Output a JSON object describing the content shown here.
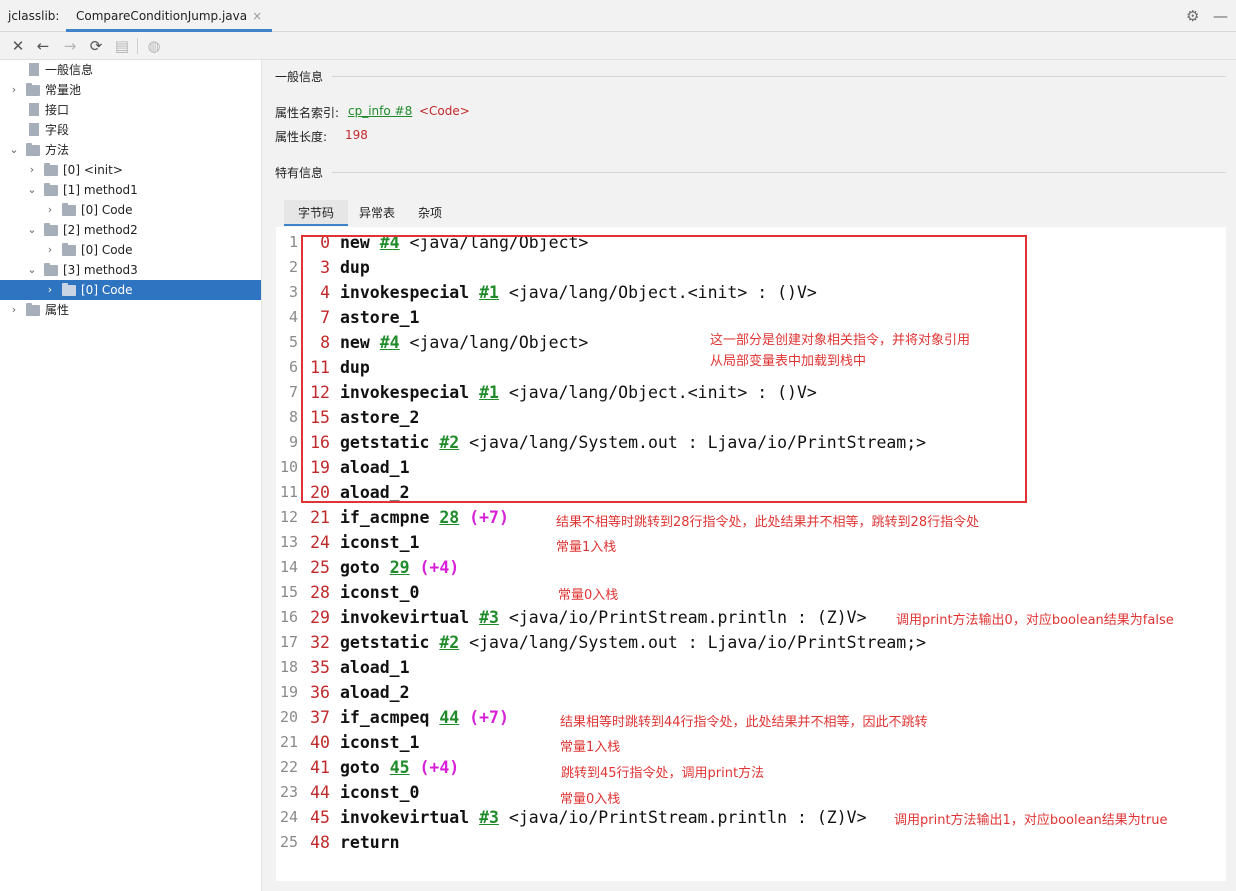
{
  "app": {
    "name": "jclasslib:",
    "file_tab": "CompareConditionJump.java",
    "tab_close": "×",
    "settings_icon": "gear-icon",
    "minimize_icon": "minus-icon"
  },
  "toolbar": {
    "close": "✕",
    "back": "←",
    "forward": "→",
    "refresh": "⟳",
    "save": "▤",
    "web": "◍"
  },
  "tree": {
    "items": [
      {
        "label": "一般信息",
        "level": 0,
        "type": "page",
        "chevron": ""
      },
      {
        "label": "常量池",
        "level": 0,
        "type": "folder",
        "chevron": "›"
      },
      {
        "label": "接口",
        "level": 0,
        "type": "page",
        "chevron": ""
      },
      {
        "label": "字段",
        "level": 0,
        "type": "page",
        "chevron": ""
      },
      {
        "label": "方法",
        "level": 0,
        "type": "folder",
        "chevron": "⌄"
      },
      {
        "label": "[0] <init>",
        "level": 1,
        "type": "folder",
        "chevron": "›"
      },
      {
        "label": "[1] method1",
        "level": 1,
        "type": "folder",
        "chevron": "⌄"
      },
      {
        "label": "[0] Code",
        "level": 2,
        "type": "folder",
        "chevron": "›"
      },
      {
        "label": "[2] method2",
        "level": 1,
        "type": "folder",
        "chevron": "⌄"
      },
      {
        "label": "[0] Code",
        "level": 2,
        "type": "folder",
        "chevron": "›"
      },
      {
        "label": "[3] method3",
        "level": 1,
        "type": "folder",
        "chevron": "⌄"
      },
      {
        "label": "[0] Code",
        "level": 2,
        "type": "folder",
        "chevron": "›",
        "selected": true
      },
      {
        "label": "属性",
        "level": 0,
        "type": "folder",
        "chevron": "›"
      }
    ]
  },
  "general": {
    "title": "一般信息",
    "name_index_label": "属性名索引:",
    "name_index_link": "cp_info #8",
    "name_index_value": "<Code>",
    "length_label": "属性长度:",
    "length_value": "198"
  },
  "specific": {
    "title": "特有信息",
    "tabs": [
      "字节码",
      "异常表",
      "杂项"
    ]
  },
  "code_lines": [
    {
      "ln": "1",
      "off": "0",
      "instr": "new",
      "ref": "#4",
      "rest": " <java/lang/Object>",
      "jump": ""
    },
    {
      "ln": "2",
      "off": "3",
      "instr": "dup",
      "ref": "",
      "rest": "",
      "jump": ""
    },
    {
      "ln": "3",
      "off": "4",
      "instr": "invokespecial",
      "ref": "#1",
      "rest": " <java/lang/Object.<init> : ()V>",
      "jump": ""
    },
    {
      "ln": "4",
      "off": "7",
      "instr": "astore_1",
      "ref": "",
      "rest": "",
      "jump": ""
    },
    {
      "ln": "5",
      "off": "8",
      "instr": "new",
      "ref": "#4",
      "rest": " <java/lang/Object>",
      "jump": ""
    },
    {
      "ln": "6",
      "off": "11",
      "instr": "dup",
      "ref": "",
      "rest": "",
      "jump": ""
    },
    {
      "ln": "7",
      "off": "12",
      "instr": "invokespecial",
      "ref": "#1",
      "rest": " <java/lang/Object.<init> : ()V>",
      "jump": ""
    },
    {
      "ln": "8",
      "off": "15",
      "instr": "astore_2",
      "ref": "",
      "rest": "",
      "jump": ""
    },
    {
      "ln": "9",
      "off": "16",
      "instr": "getstatic",
      "ref": "#2",
      "rest": " <java/lang/System.out : Ljava/io/PrintStream;>",
      "jump": ""
    },
    {
      "ln": "10",
      "off": "19",
      "instr": "aload_1",
      "ref": "",
      "rest": "",
      "jump": ""
    },
    {
      "ln": "11",
      "off": "20",
      "instr": "aload_2",
      "ref": "",
      "rest": "",
      "jump": ""
    },
    {
      "ln": "12",
      "off": "21",
      "instr": "if_acmpne",
      "ref": "28",
      "rest": " ",
      "jump": "(+7)"
    },
    {
      "ln": "13",
      "off": "24",
      "instr": "iconst_1",
      "ref": "",
      "rest": "",
      "jump": ""
    },
    {
      "ln": "14",
      "off": "25",
      "instr": "goto",
      "ref": "29",
      "rest": " ",
      "jump": "(+4)"
    },
    {
      "ln": "15",
      "off": "28",
      "instr": "iconst_0",
      "ref": "",
      "rest": "",
      "jump": ""
    },
    {
      "ln": "16",
      "off": "29",
      "instr": "invokevirtual",
      "ref": "#3",
      "rest": " <java/io/PrintStream.println : (Z)V>",
      "jump": ""
    },
    {
      "ln": "17",
      "off": "32",
      "instr": "getstatic",
      "ref": "#2",
      "rest": " <java/lang/System.out : Ljava/io/PrintStream;>",
      "jump": ""
    },
    {
      "ln": "18",
      "off": "35",
      "instr": "aload_1",
      "ref": "",
      "rest": "",
      "jump": ""
    },
    {
      "ln": "19",
      "off": "36",
      "instr": "aload_2",
      "ref": "",
      "rest": "",
      "jump": ""
    },
    {
      "ln": "20",
      "off": "37",
      "instr": "if_acmpeq",
      "ref": "44",
      "rest": " ",
      "jump": "(+7)"
    },
    {
      "ln": "21",
      "off": "40",
      "instr": "iconst_1",
      "ref": "",
      "rest": "",
      "jump": ""
    },
    {
      "ln": "22",
      "off": "41",
      "instr": "goto",
      "ref": "45",
      "rest": " ",
      "jump": "(+4)"
    },
    {
      "ln": "23",
      "off": "44",
      "instr": "iconst_0",
      "ref": "",
      "rest": "",
      "jump": ""
    },
    {
      "ln": "24",
      "off": "45",
      "instr": "invokevirtual",
      "ref": "#3",
      "rest": " <java/io/PrintStream.println : (Z)V>",
      "jump": ""
    },
    {
      "ln": "25",
      "off": "48",
      "instr": "return",
      "ref": "",
      "rest": "",
      "jump": ""
    }
  ],
  "annotations": {
    "box_note_1": "这一部分是创建对象相关指令，并将对象引用",
    "box_note_2": "从局部变量表中加载到栈中",
    "note_12": "结果不相等时跳转到28行指令处，此处结果并不相等，跳转到28行指令处",
    "note_13": "常量1入栈",
    "note_15": "常量0入栈",
    "note_16": "调用print方法输出0，对应boolean结果为false",
    "note_20": "结果相等时跳转到44行指令处，此处结果并不相等，因此不跳转",
    "note_21": "常量1入栈",
    "note_22": "跳转到45行指令处，调用print方法",
    "note_23": "常量0入栈",
    "note_24": "调用print方法输出1，对应boolean结果为true"
  },
  "colors": {
    "accent": "#4083c9",
    "selection": "#2f74c0",
    "offset_red": "#c0282a",
    "ref_green": "#1f8b2a",
    "jump_magenta": "#d61fd6",
    "annotation_red": "#e03434"
  }
}
